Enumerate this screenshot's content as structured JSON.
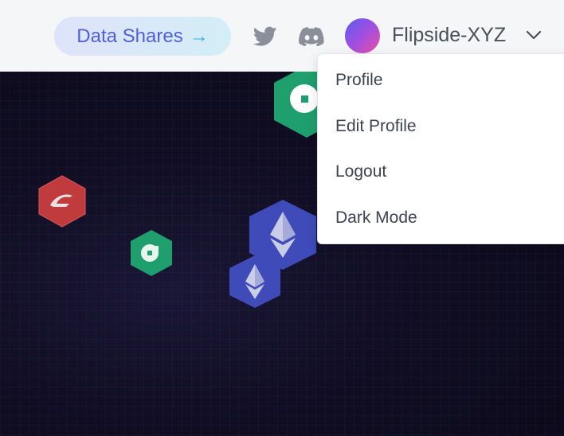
{
  "header": {
    "data_shares_label": "Data Shares",
    "data_shares_arrow": "→",
    "username": "Flipside-XYZ"
  },
  "icons": {
    "twitter": "twitter-icon",
    "discord": "discord-icon",
    "chevron": "chevron-down-icon"
  },
  "dropdown": {
    "items": [
      {
        "label": "Profile"
      },
      {
        "label": "Edit Profile"
      },
      {
        "label": "Logout"
      },
      {
        "label": "Dark Mode"
      }
    ]
  },
  "hero": {
    "tokens": [
      "flow-token",
      "ethereum-token",
      "flow-token",
      "ethereum-token",
      "red-token"
    ]
  },
  "colors": {
    "accent_blue": "#4f5ee0",
    "accent_cyan": "#2ab0d8",
    "hero_bg": "#100d23",
    "flow_green": "#1f9e6e",
    "eth_blue": "#3e4bb8",
    "red_token": "#c03b3b"
  }
}
